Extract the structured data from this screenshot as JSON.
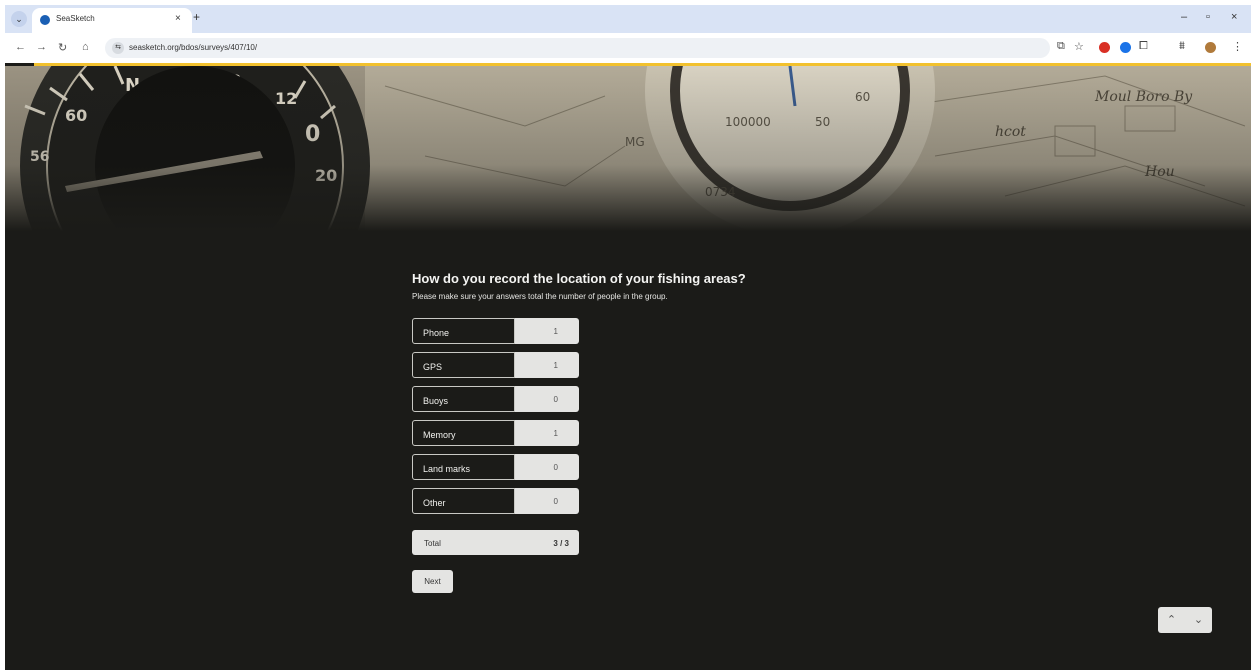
{
  "browser": {
    "tab_title": "SeaSketch",
    "tab_close": "×",
    "new_tab": "+",
    "tab_menu": "⌄",
    "url": "seasketch.org/bdos/surveys/407/10/",
    "site_info": "⇆",
    "nav": {
      "back": "←",
      "forward": "→",
      "reload": "↻",
      "home": "⌂"
    },
    "window": {
      "minimize": "–",
      "maximize": "▫",
      "close": "×"
    },
    "toolbar_icons": [
      "cast-icon",
      "star-icon",
      "stop-extension-icon",
      "blue-extension-icon",
      "puzzle-icon",
      "tab-search-icon",
      "profile-icon",
      "menu-icon"
    ],
    "toolbar_glyphs": {
      "cast": "⧉",
      "star": "☆",
      "puzzle": "⧠",
      "tab_search": "⩩",
      "menu": "⋮"
    },
    "accent_color": "#f2c12e"
  },
  "survey": {
    "question": "How do you record the location of your fishing areas?",
    "hint": "Please make sure your answers total the number of people in the group.",
    "options": [
      {
        "label": "Phone",
        "value": "1"
      },
      {
        "label": "GPS",
        "value": "1"
      },
      {
        "label": "Buoys",
        "value": "0"
      },
      {
        "label": "Memory",
        "value": "1"
      },
      {
        "label": "Land marks",
        "value": "0"
      },
      {
        "label": "Other",
        "value": "0"
      }
    ],
    "total_label": "Total",
    "total_value": "3 / 3",
    "next_label": "Next",
    "up_arrow": "⌃",
    "down_arrow": "⌄"
  }
}
